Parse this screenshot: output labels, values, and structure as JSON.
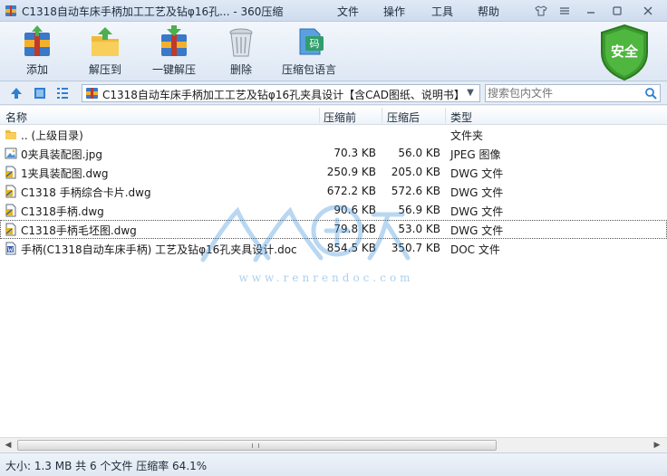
{
  "window": {
    "title": "C1318自动车床手柄加工工艺及钻φ16孔... - 360压缩",
    "menu": [
      "文件",
      "操作",
      "工具",
      "帮助"
    ]
  },
  "toolbar": {
    "buttons": [
      {
        "label": "添加",
        "icon": "add-archive-icon"
      },
      {
        "label": "解压到",
        "icon": "extract-to-icon"
      },
      {
        "label": "一键解压",
        "icon": "one-click-extract-icon"
      },
      {
        "label": "删除",
        "icon": "trash-icon"
      },
      {
        "label": "压缩包语言",
        "icon": "archive-language-icon"
      }
    ],
    "security_badge": "安全"
  },
  "addressbar": {
    "path": "C1318自动车床手柄加工工艺及钻φ16孔夹具设计【含CAD图纸、说明书】.rar",
    "search_placeholder": "搜索包内文件"
  },
  "columns": {
    "name": "名称",
    "size": "压缩前",
    "packed": "压缩后",
    "type": "类型"
  },
  "files": [
    {
      "name": ".. (上级目录)",
      "size": "",
      "packed": "",
      "type": "文件夹",
      "icon": "folder-icon"
    },
    {
      "name": "0夹具装配图.jpg",
      "size": "70.3 KB",
      "packed": "56.0 KB",
      "type": "JPEG 图像",
      "icon": "image-file-icon"
    },
    {
      "name": "1夹具装配图.dwg",
      "size": "250.9 KB",
      "packed": "205.0 KB",
      "type": "DWG 文件",
      "icon": "dwg-file-icon"
    },
    {
      "name": "C1318 手柄综合卡片.dwg",
      "size": "672.2 KB",
      "packed": "572.6 KB",
      "type": "DWG 文件",
      "icon": "dwg-file-icon"
    },
    {
      "name": "C1318手柄.dwg",
      "size": "90.6 KB",
      "packed": "56.9 KB",
      "type": "DWG 文件",
      "icon": "dwg-file-icon"
    },
    {
      "name": "C1318手柄毛坯图.dwg",
      "size": "79.8 KB",
      "packed": "53.0 KB",
      "type": "DWG 文件",
      "icon": "dwg-file-icon"
    },
    {
      "name": "手柄(C1318自动车床手柄) 工艺及钻φ16孔夹具设计.doc",
      "size": "854.5 KB",
      "packed": "350.7 KB",
      "type": "DOC 文件",
      "icon": "doc-file-icon"
    }
  ],
  "watermark": "www.renrendoc.com",
  "status": "大小: 1.3 MB 共 6 个文件 压缩率 64.1%",
  "colors": {
    "accent": "#2f7fd1",
    "badge_green": "#3c9a2e",
    "selection_outline": "#555555"
  }
}
